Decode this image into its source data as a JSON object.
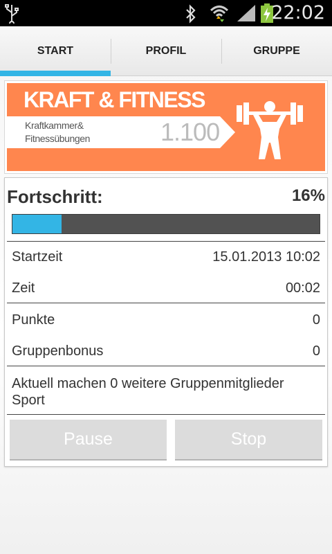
{
  "status_bar": {
    "time": "22:02",
    "icons": [
      "usb-icon",
      "bluetooth-icon",
      "wifi-icon",
      "signal-icon",
      "battery-charging-icon"
    ]
  },
  "tabs": [
    {
      "label": "START",
      "active": true
    },
    {
      "label": "PROFIL",
      "active": false
    },
    {
      "label": "GRUPPE",
      "active": false
    }
  ],
  "banner": {
    "title": "KRAFT & FITNESS",
    "subtitle": "Kraftkammer& Fitnessübungen",
    "number": "1.100",
    "background_color": "#ff864e"
  },
  "progress": {
    "label": "Fortschritt:",
    "percent_text": "16%",
    "value": 0.16,
    "fill_color": "#33b5e5"
  },
  "details": {
    "start_label": "Startzeit",
    "start_value": "15.01.2013 10:02",
    "time_label": "Zeit",
    "time_value": "00:02",
    "points_label": "Punkte",
    "points_value": "0",
    "bonus_label": "Gruppenbonus",
    "bonus_value": "0",
    "note": "Aktuell machen 0 weitere Gruppenmitglieder Sport"
  },
  "buttons": {
    "pause": "Pause",
    "stop": "Stop"
  },
  "accent_color": "#33b5e5"
}
